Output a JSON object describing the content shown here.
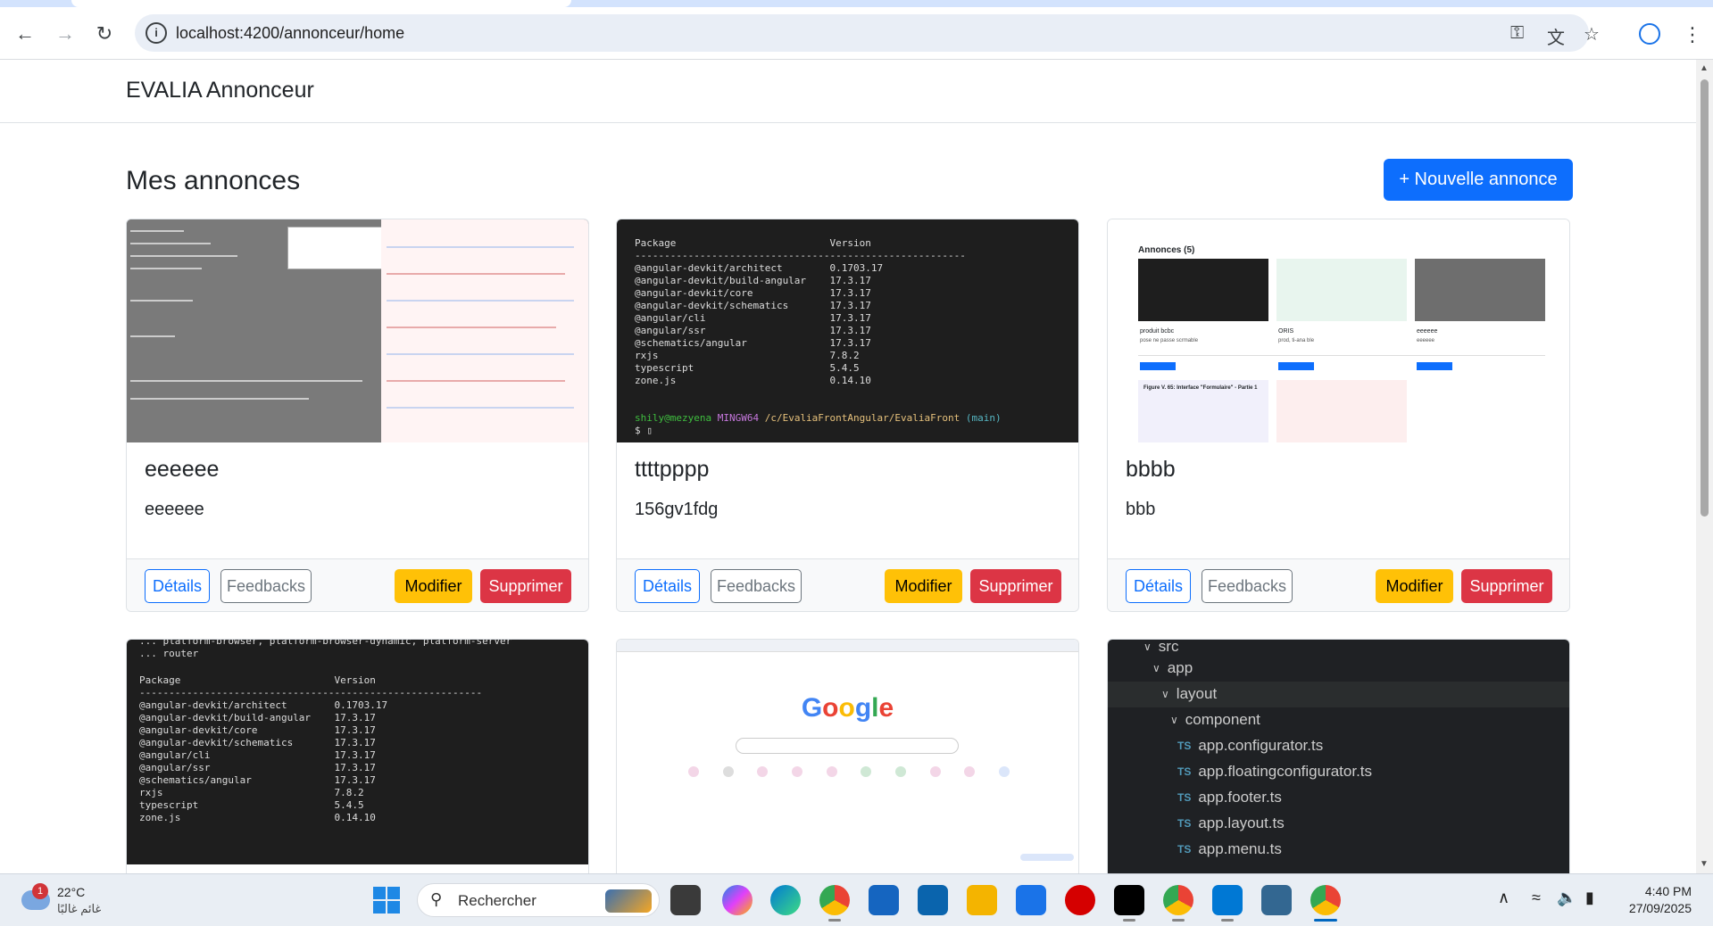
{
  "browser": {
    "url": "localhost:4200/annonceur/home",
    "back_icon": "arrow-left",
    "forward_icon": "arrow-right",
    "reload_icon": "reload",
    "info_icon": "info",
    "key_icon": "key",
    "translate_icon": "translate",
    "star_icon": "star",
    "profile_icon": "profile",
    "menu_icon": "kebab"
  },
  "app": {
    "brand": "EVALIA Annonceur",
    "page_title": "Mes annonces",
    "new_button": "+ Nouvelle annonce"
  },
  "cards": [
    {
      "title": "eeeeee",
      "text": "eeeeee",
      "details": "Détails",
      "feedbacks": "Feedbacks",
      "modify": "Modifier",
      "delete": "Supprimer"
    },
    {
      "title": "ttttpppp",
      "text": "156gv1fdg",
      "details": "Détails",
      "feedbacks": "Feedbacks",
      "modify": "Modifier",
      "delete": "Supprimer"
    },
    {
      "title": "bbbb",
      "text": "bbb",
      "details": "Détails",
      "feedbacks": "Feedbacks",
      "modify": "Modifier",
      "delete": "Supprimer"
    }
  ],
  "thumbnails": {
    "terminal1": {
      "header": "Package                          Version",
      "separator": "--------------------------------------------------------",
      "rows": [
        "@angular-devkit/architect        0.1703.17",
        "@angular-devkit/build-angular    17.3.17",
        "@angular-devkit/core             17.3.17",
        "@angular-devkit/schematics       17.3.17",
        "@angular/cli                     17.3.17",
        "@angular/ssr                     17.3.17",
        "@schematics/angular              17.3.17",
        "rxjs                             7.8.2",
        "typescript                       5.4.5",
        "zone.js                          0.14.10"
      ],
      "prompt_user": "shily@mezyena",
      "prompt_host": "MINGW64",
      "prompt_path": "/c/EvaliaFrontAngular/EvaliaFront",
      "prompt_branch": "(main)"
    },
    "terminal2": {
      "pre_lines": [
        "... platform-browser, platform-browser-dynamic, platform-server",
        "... router"
      ],
      "header": "Package                          Version",
      "separator": "----------------------------------------------------------",
      "rows": [
        "@angular-devkit/architect        0.1703.17",
        "@angular-devkit/build-angular    17.3.17",
        "@angular-devkit/core             17.3.17",
        "@angular-devkit/schematics       17.3.17",
        "@angular/cli                     17.3.17",
        "@angular/ssr                     17.3.17",
        "@schematics/angular              17.3.17",
        "rxjs                             7.8.2",
        "typescript                       5.4.5",
        "zone.js                          0.14.10"
      ]
    },
    "bbbb_shot": {
      "header": "Annonces (5)",
      "items": [
        {
          "name": "produit bcbc",
          "desc": "pose ne passe scrmable"
        },
        {
          "name": "ORIS",
          "desc": "prod, ti-ana ble"
        },
        {
          "name": "eeeeee",
          "desc": "eeeeee"
        }
      ],
      "figure_caption": "Figure V. 65: Interface \"Formulaire\" - Partie 1"
    },
    "google": {
      "logo": "Google"
    },
    "tree": {
      "items": [
        {
          "label": "src",
          "kind": "folder",
          "level": 0
        },
        {
          "label": "app",
          "kind": "folder",
          "level": 1
        },
        {
          "label": "layout",
          "kind": "folder",
          "level": 2
        },
        {
          "label": "component",
          "kind": "folder",
          "level": 3
        },
        {
          "label": "app.configurator.ts",
          "kind": "file",
          "level": 4
        },
        {
          "label": "app.floatingconfigurator.ts",
          "kind": "file",
          "level": 4
        },
        {
          "label": "app.footer.ts",
          "kind": "file",
          "level": 4
        },
        {
          "label": "app.layout.ts",
          "kind": "file",
          "level": 4
        },
        {
          "label": "app.menu.ts",
          "kind": "file",
          "level": 4
        }
      ],
      "ts_badge": "TS"
    }
  },
  "taskbar": {
    "weather_badge": "1",
    "temperature": "22°C",
    "weather_desc": "غائم غالبًا",
    "search_placeholder": "Rechercher",
    "time": "4:40 PM",
    "date": "27/09/2025"
  }
}
